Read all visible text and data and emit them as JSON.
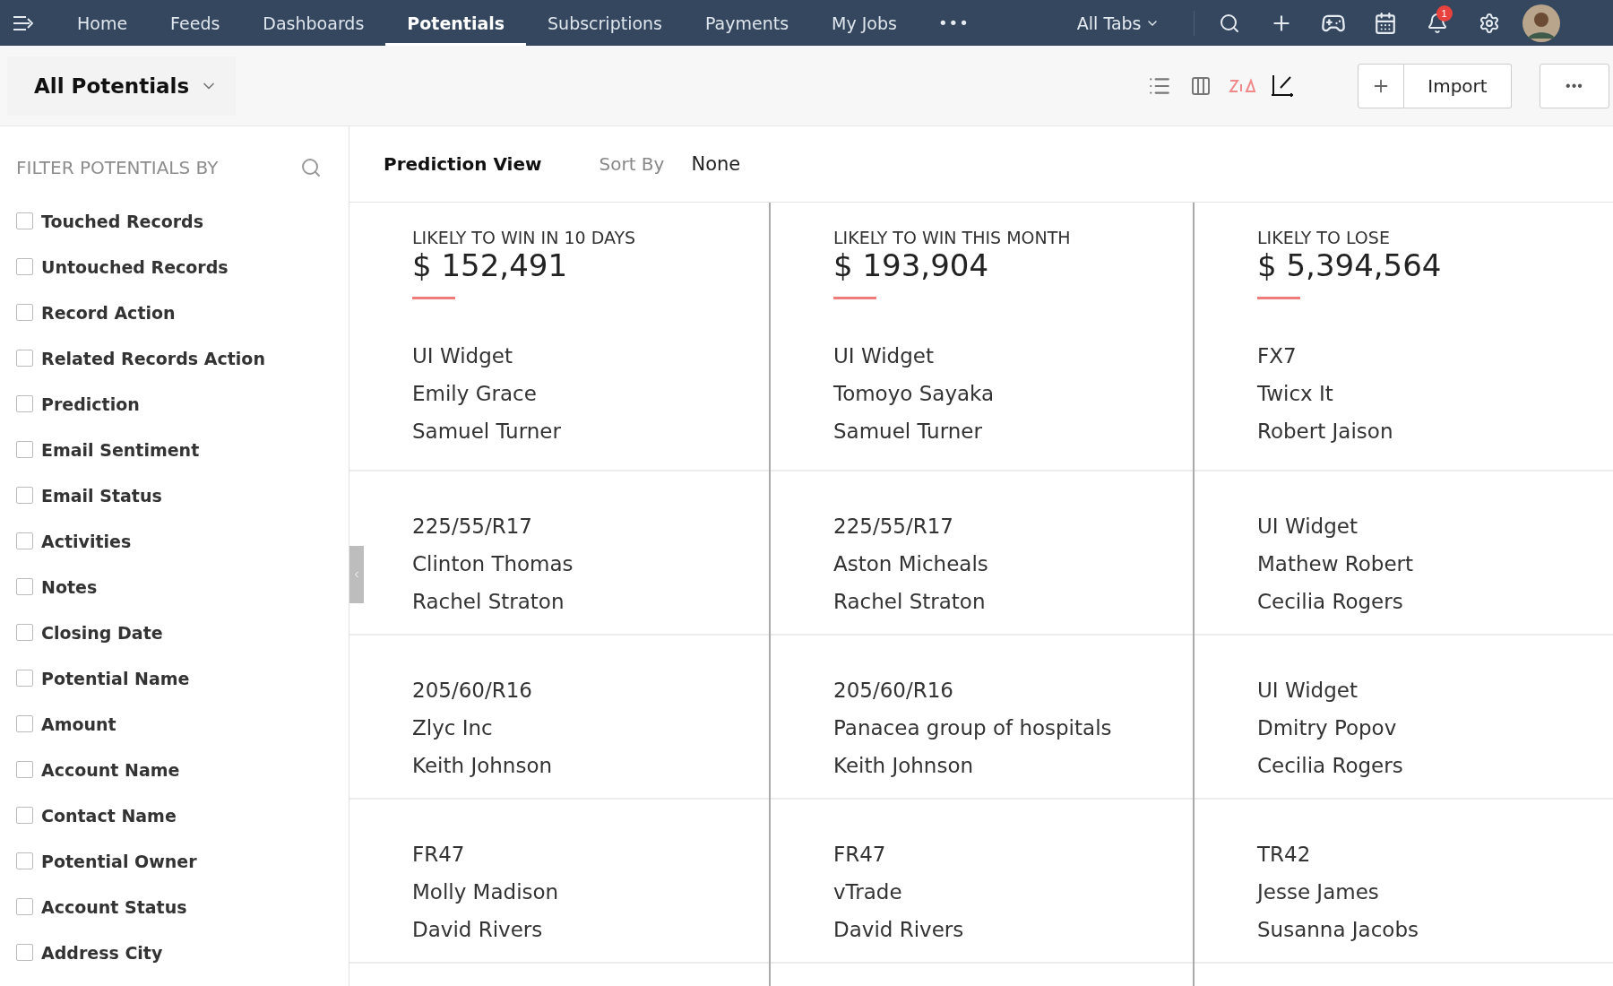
{
  "nav": {
    "items": [
      {
        "label": "Home",
        "selected": false
      },
      {
        "label": "Feeds",
        "selected": false
      },
      {
        "label": "Dashboards",
        "selected": false
      },
      {
        "label": "Potentials",
        "selected": true
      },
      {
        "label": "Subscriptions",
        "selected": false
      },
      {
        "label": "Payments",
        "selected": false
      },
      {
        "label": "My Jobs",
        "selected": false
      }
    ],
    "more": "•••",
    "all_tabs": "All Tabs",
    "notification_count": "1"
  },
  "toolbar": {
    "view_selector": "All Potentials",
    "import_button": "Import",
    "more_button": "•••"
  },
  "sidebar": {
    "title": "FILTER POTENTIALS BY",
    "filters": [
      {
        "label": "Touched Records",
        "checked": false
      },
      {
        "label": "Untouched Records",
        "checked": false
      },
      {
        "label": "Record Action",
        "checked": false
      },
      {
        "label": "Related Records Action",
        "checked": false
      },
      {
        "label": "Prediction",
        "checked": false
      },
      {
        "label": "Email Sentiment",
        "checked": false
      },
      {
        "label": "Email Status",
        "checked": false
      },
      {
        "label": "Activities",
        "checked": false
      },
      {
        "label": "Notes",
        "checked": false
      },
      {
        "label": "Closing Date",
        "checked": false
      },
      {
        "label": "Potential Name",
        "checked": false
      },
      {
        "label": "Amount",
        "checked": false
      },
      {
        "label": "Account Name",
        "checked": false
      },
      {
        "label": "Contact Name",
        "checked": false
      },
      {
        "label": "Potential Owner",
        "checked": false
      },
      {
        "label": "Account Status",
        "checked": false
      },
      {
        "label": "Address City",
        "checked": false
      }
    ]
  },
  "content": {
    "view_title": "Prediction View",
    "sort_label": "Sort By",
    "sort_value": "None",
    "columns": [
      {
        "heading": "LIKELY TO WIN IN 10 DAYS",
        "amount": "$ 152,491",
        "records": [
          [
            "UI Widget",
            "Emily Grace",
            "Samuel Turner"
          ],
          [
            "225/55/R17",
            "Clinton Thomas",
            "Rachel Straton"
          ],
          [
            "205/60/R16",
            "Zlyc Inc",
            "Keith Johnson"
          ],
          [
            "FR47",
            "Molly Madison",
            "David Rivers"
          ]
        ]
      },
      {
        "heading": "LIKELY TO WIN THIS MONTH",
        "amount": "$ 193,904",
        "records": [
          [
            "UI Widget",
            "Tomoyo Sayaka",
            "Samuel Turner"
          ],
          [
            "225/55/R17",
            "Aston Micheals",
            "Rachel Straton"
          ],
          [
            "205/60/R16",
            "Panacea group of hospitals",
            "Keith Johnson"
          ],
          [
            "FR47",
            "vTrade",
            "David Rivers"
          ]
        ]
      },
      {
        "heading": "LIKELY TO LOSE",
        "amount": "$ 5,394,564",
        "records": [
          [
            "FX7",
            "Twicx It",
            "Robert Jaison"
          ],
          [
            "UI Widget",
            "Mathew Robert",
            "Cecilia Rogers"
          ],
          [
            "UI Widget",
            "Dmitry Popov",
            "Cecilia Rogers"
          ],
          [
            "TR42",
            "Jesse James",
            "Susanna Jacobs"
          ]
        ]
      }
    ]
  }
}
